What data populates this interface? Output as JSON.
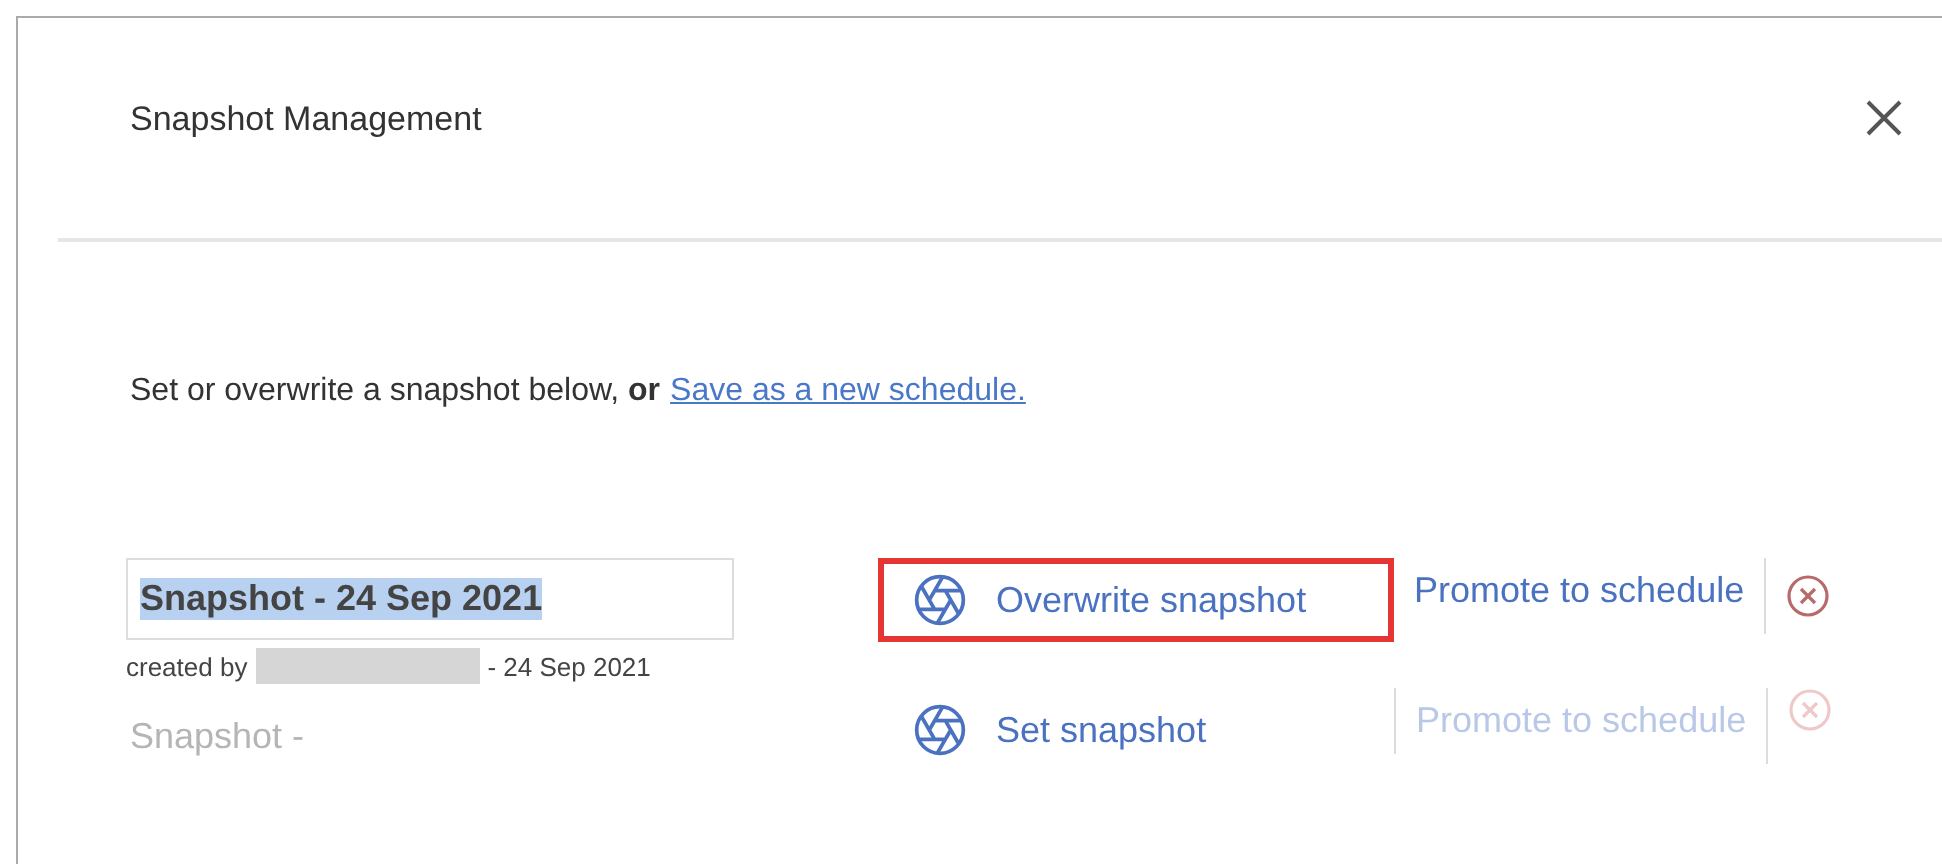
{
  "dialog": {
    "title": "Snapshot Management",
    "intro": "Set or overwrite a snapshot below, **or**",
    "intro_link": "Save as a new schedule."
  },
  "snapshots": [
    {
      "kind": "existing",
      "name": "Snapshot - 24 Sep 2021",
      "name_selected": true,
      "created_by_label": "created by",
      "created_date": "- 24 Sep 2021",
      "action": "Overwrite snapshot",
      "action_highlighted": true,
      "promote": "Promote to schedule",
      "disabled": false
    },
    {
      "kind": "empty",
      "name": "Snapshot -",
      "action": "Set snapshot",
      "action_highlighted": false,
      "promote": "Promote to schedule",
      "disabled": true
    }
  ]
}
